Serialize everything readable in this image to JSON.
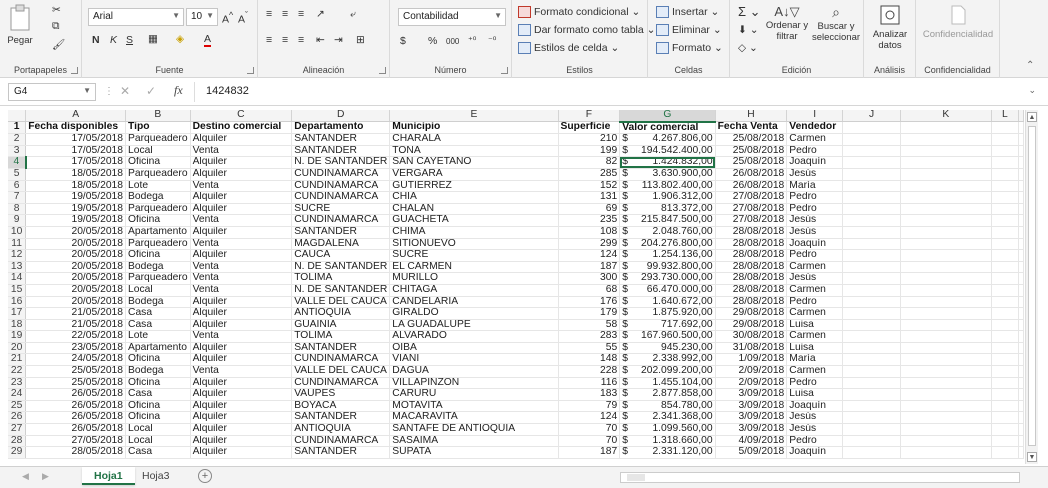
{
  "ribbon": {
    "clipboard": {
      "paste": "Pegar",
      "label": "Portapapeles"
    },
    "font": {
      "name": "Arial",
      "size": "10",
      "bold": "N",
      "italic": "K",
      "underline": "S",
      "label": "Fuente"
    },
    "alignment": {
      "label": "Alineación"
    },
    "number": {
      "format": "Contabilidad",
      "currency": "$",
      "percent": "%",
      "thousands": "000",
      "label": "Número"
    },
    "styles": {
      "conditional": "Formato condicional",
      "table": "Dar formato como tabla",
      "cell_styles": "Estilos de celda",
      "label": "Estilos"
    },
    "cells": {
      "insert": "Insertar",
      "delete": "Eliminar",
      "format": "Formato",
      "label": "Celdas"
    },
    "editing": {
      "sort": "Ordenar y filtrar",
      "find": "Buscar y seleccionar",
      "label": "Edición"
    },
    "analysis": {
      "analyze": "Analizar datos",
      "label": "Análisis"
    },
    "confidentiality": {
      "button": "Confidencialidad",
      "label": "Confidencialidad"
    }
  },
  "formula_bar": {
    "name_box": "G4",
    "fx": "fx",
    "value": "1424832"
  },
  "grid": {
    "columns": [
      "A",
      "B",
      "C",
      "D",
      "E",
      "F",
      "G",
      "H",
      "I",
      "J",
      "K",
      "L"
    ],
    "header_row": [
      "Fecha disponibles",
      "Tipo",
      "Destino comercial",
      "Departamento",
      "Municipio",
      "Superficie",
      "Valor comercial",
      "Fecha Venta",
      "Vendedor"
    ],
    "rows": [
      [
        "17/05/2018",
        "Parqueadero",
        "Alquiler",
        "SANTANDER",
        "CHARALA",
        "210",
        "$",
        "4.267.806,00",
        "25/08/2018",
        "Carmen"
      ],
      [
        "17/05/2018",
        "Local",
        "Venta",
        "SANTANDER",
        "TONA",
        "199",
        "$",
        "194.542.400,00",
        "25/08/2018",
        "Pedro"
      ],
      [
        "17/05/2018",
        "Oficina",
        "Alquiler",
        "N. DE SANTANDER",
        "SAN CAYETANO",
        "82",
        "$",
        "1.424.832,00",
        "25/08/2018",
        "Joaquín"
      ],
      [
        "18/05/2018",
        "Parqueadero",
        "Alquiler",
        "CUNDINAMARCA",
        "VERGARA",
        "285",
        "$",
        "3.630.900,00",
        "26/08/2018",
        "Jesús"
      ],
      [
        "18/05/2018",
        "Lote",
        "Venta",
        "CUNDINAMARCA",
        "GUTIERREZ",
        "152",
        "$",
        "113.802.400,00",
        "26/08/2018",
        "María"
      ],
      [
        "19/05/2018",
        "Bodega",
        "Alquiler",
        "CUNDINAMARCA",
        "CHIA",
        "131",
        "$",
        "1.906.312,00",
        "27/08/2018",
        "Pedro"
      ],
      [
        "19/05/2018",
        "Parqueadero",
        "Alquiler",
        "SUCRE",
        "CHALAN",
        "69",
        "$",
        "813.372,00",
        "27/08/2018",
        "Pedro"
      ],
      [
        "19/05/2018",
        "Oficina",
        "Venta",
        "CUNDINAMARCA",
        "GUACHETA",
        "235",
        "$",
        "215.847.500,00",
        "27/08/2018",
        "Jesús"
      ],
      [
        "20/05/2018",
        "Apartamento",
        "Alquiler",
        "SANTANDER",
        "CHIMA",
        "108",
        "$",
        "2.048.760,00",
        "28/08/2018",
        "Jesús"
      ],
      [
        "20/05/2018",
        "Parqueadero",
        "Venta",
        "MAGDALENA",
        "SITIONUEVO",
        "299",
        "$",
        "204.276.800,00",
        "28/08/2018",
        "Joaquín"
      ],
      [
        "20/05/2018",
        "Oficina",
        "Alquiler",
        "CAUCA",
        "SUCRE",
        "124",
        "$",
        "1.254.136,00",
        "28/08/2018",
        "Pedro"
      ],
      [
        "20/05/2018",
        "Bodega",
        "Venta",
        "N. DE SANTANDER",
        "EL CARMEN",
        "187",
        "$",
        "99.932.800,00",
        "28/08/2018",
        "Carmen"
      ],
      [
        "20/05/2018",
        "Parqueadero",
        "Venta",
        "TOLIMA",
        "MURILLO",
        "300",
        "$",
        "293.730.000,00",
        "28/08/2018",
        "Jesús"
      ],
      [
        "20/05/2018",
        "Local",
        "Venta",
        "N. DE SANTANDER",
        "CHITAGA",
        "68",
        "$",
        "66.470.000,00",
        "28/08/2018",
        "Carmen"
      ],
      [
        "20/05/2018",
        "Bodega",
        "Alquiler",
        "VALLE DEL CAUCA",
        "CANDELARIA",
        "176",
        "$",
        "1.640.672,00",
        "28/08/2018",
        "Pedro"
      ],
      [
        "21/05/2018",
        "Casa",
        "Alquiler",
        "ANTIOQUIA",
        "GIRALDO",
        "179",
        "$",
        "1.875.920,00",
        "29/08/2018",
        "Carmen"
      ],
      [
        "21/05/2018",
        "Casa",
        "Alquiler",
        "GUAINIA",
        "LA GUADALUPE",
        "58",
        "$",
        "717.692,00",
        "29/08/2018",
        "Luisa"
      ],
      [
        "22/05/2018",
        "Lote",
        "Venta",
        "TOLIMA",
        "ALVARADO",
        "283",
        "$",
        "167.960.500,00",
        "30/08/2018",
        "Carmen"
      ],
      [
        "23/05/2018",
        "Apartamento",
        "Alquiler",
        "SANTANDER",
        "OIBA",
        "55",
        "$",
        "945.230,00",
        "31/08/2018",
        "Luisa"
      ],
      [
        "24/05/2018",
        "Oficina",
        "Alquiler",
        "CUNDINAMARCA",
        "VIANI",
        "148",
        "$",
        "2.338.992,00",
        "1/09/2018",
        "María"
      ],
      [
        "25/05/2018",
        "Bodega",
        "Venta",
        "VALLE DEL CAUCA",
        "DAGUA",
        "228",
        "$",
        "202.099.200,00",
        "2/09/2018",
        "Carmen"
      ],
      [
        "25/05/2018",
        "Oficina",
        "Alquiler",
        "CUNDINAMARCA",
        "VILLAPINZON",
        "116",
        "$",
        "1.455.104,00",
        "2/09/2018",
        "Pedro"
      ],
      [
        "26/05/2018",
        "Casa",
        "Alquiler",
        "VAUPES",
        "CARURU",
        "183",
        "$",
        "2.877.858,00",
        "3/09/2018",
        "Luisa"
      ],
      [
        "26/05/2018",
        "Oficina",
        "Alquiler",
        "BOYACA",
        "MOTAVITA",
        "79",
        "$",
        "854.780,00",
        "3/09/2018",
        "Joaquín"
      ],
      [
        "26/05/2018",
        "Oficina",
        "Alquiler",
        "SANTANDER",
        "MACARAVITA",
        "124",
        "$",
        "2.341.368,00",
        "3/09/2018",
        "Jesús"
      ],
      [
        "26/05/2018",
        "Local",
        "Alquiler",
        "ANTIOQUIA",
        "SANTAFE DE ANTIOQUIA",
        "70",
        "$",
        "1.099.560,00",
        "3/09/2018",
        "Jesús"
      ],
      [
        "27/05/2018",
        "Local",
        "Alquiler",
        "CUNDINAMARCA",
        "SASAIMA",
        "70",
        "$",
        "1.318.660,00",
        "4/09/2018",
        "Pedro"
      ],
      [
        "28/05/2018",
        "Casa",
        "Alquiler",
        "SANTANDER",
        "SUPATA",
        "187",
        "$",
        "2.331.120,00",
        "5/09/2018",
        "Joaquín"
      ]
    ]
  },
  "sheets": {
    "tabs": [
      "Hoja1",
      "Hoja3"
    ],
    "add": "+"
  },
  "colors": {
    "accent": "#217346",
    "header_bg": "#f4f4f4",
    "ribbon_bg": "#f3f3f3"
  }
}
